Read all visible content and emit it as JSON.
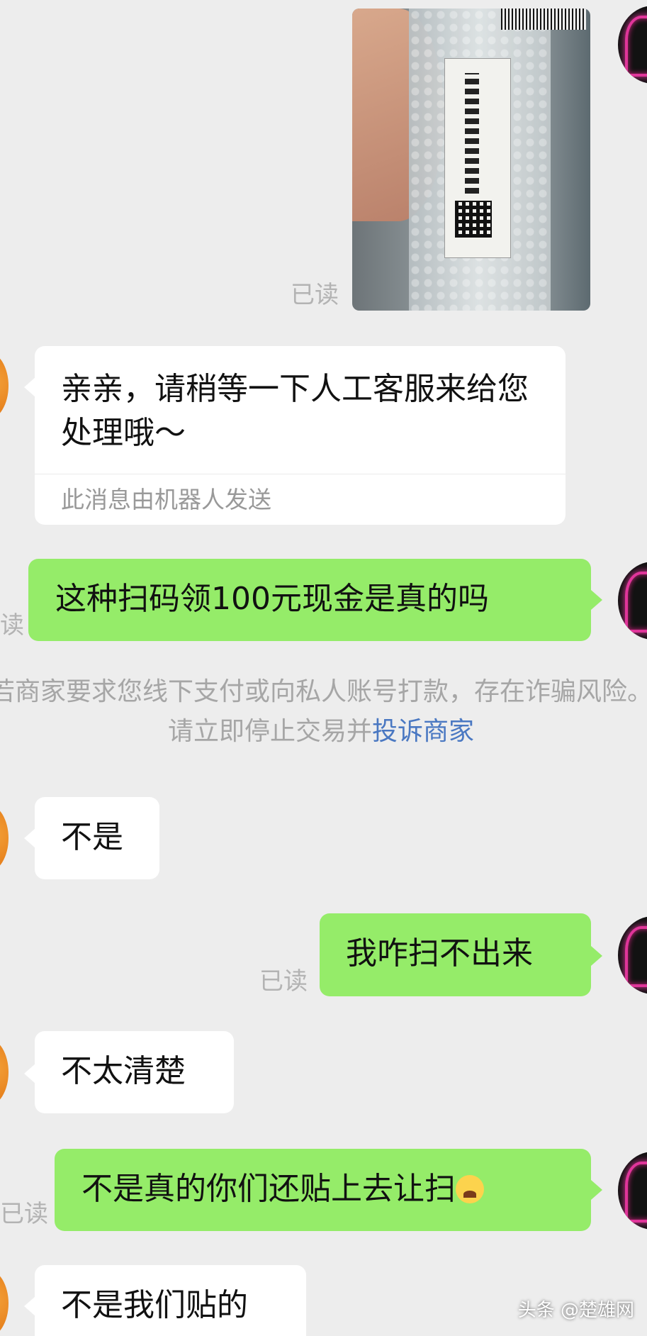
{
  "messages": {
    "photo_read": "已读",
    "bot_reply": {
      "text": "亲亲，请稍等一下人工客服来给您处理哦～",
      "footer": "此消息由机器人发送"
    },
    "user_q1": {
      "text": "这种扫码领100元现金是真的吗",
      "read": "读"
    },
    "system_warning": {
      "text": "若商家要求您线下支付或向私人账号打款，存在诈骗风险。请立即停止交易并",
      "link": "投诉商家"
    },
    "merchant_1": "不是",
    "user_q2": {
      "text": "我咋扫不出来",
      "read": "已读"
    },
    "merchant_2": "不太清楚",
    "user_q3": {
      "text": "不是真的你们还贴上去让扫",
      "read": "已读",
      "emoji": "crying-face"
    },
    "merchant_3": "不是我们贴的"
  },
  "watermark": "头条 @楚雄网",
  "colors": {
    "background": "#ededed",
    "user_bubble": "#95ec69",
    "merchant_bubble": "#ffffff",
    "link": "#4a78c2"
  }
}
